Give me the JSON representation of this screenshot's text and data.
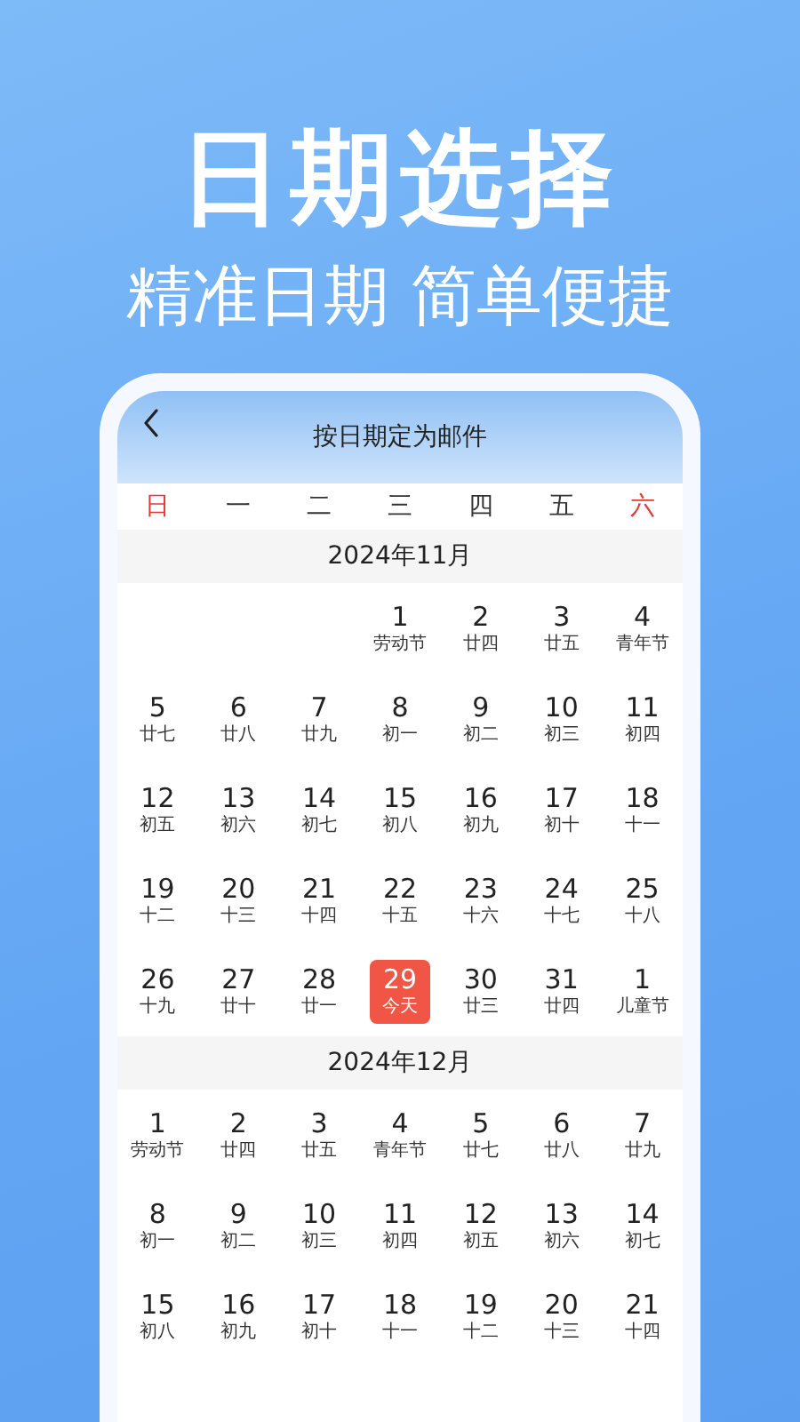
{
  "headline": "日期选择",
  "subtitle": "精准日期 简单便捷",
  "screen": {
    "title": "按日期定为邮件",
    "weekdays": [
      {
        "label": "日",
        "weekend": true
      },
      {
        "label": "一",
        "weekend": false
      },
      {
        "label": "二",
        "weekend": false
      },
      {
        "label": "三",
        "weekend": false
      },
      {
        "label": "四",
        "weekend": false
      },
      {
        "label": "五",
        "weekend": false
      },
      {
        "label": "六",
        "weekend": true
      }
    ],
    "months": [
      {
        "title": "2024年11月",
        "weeks": [
          [
            {
              "kind": "blank"
            },
            {
              "kind": "blank"
            },
            {
              "kind": "blank"
            },
            {
              "kind": "day",
              "day": "1",
              "note": "劳动节",
              "selected": false
            },
            {
              "kind": "day",
              "day": "2",
              "note": "廿四",
              "selected": false
            },
            {
              "kind": "day",
              "day": "3",
              "note": "廿五",
              "selected": false
            },
            {
              "kind": "day",
              "day": "4",
              "note": "青年节",
              "selected": false
            }
          ],
          [
            {
              "kind": "day",
              "day": "5",
              "note": "廿七",
              "selected": false
            },
            {
              "kind": "day",
              "day": "6",
              "note": "廿八",
              "selected": false
            },
            {
              "kind": "day",
              "day": "7",
              "note": "廿九",
              "selected": false
            },
            {
              "kind": "day",
              "day": "8",
              "note": "初一",
              "selected": false
            },
            {
              "kind": "day",
              "day": "9",
              "note": "初二",
              "selected": false
            },
            {
              "kind": "day",
              "day": "10",
              "note": "初三",
              "selected": false
            },
            {
              "kind": "day",
              "day": "11",
              "note": "初四",
              "selected": false
            }
          ],
          [
            {
              "kind": "day",
              "day": "12",
              "note": "初五",
              "selected": false
            },
            {
              "kind": "day",
              "day": "13",
              "note": "初六",
              "selected": false
            },
            {
              "kind": "day",
              "day": "14",
              "note": "初七",
              "selected": false
            },
            {
              "kind": "day",
              "day": "15",
              "note": "初八",
              "selected": false
            },
            {
              "kind": "day",
              "day": "16",
              "note": "初九",
              "selected": false
            },
            {
              "kind": "day",
              "day": "17",
              "note": "初十",
              "selected": false
            },
            {
              "kind": "day",
              "day": "18",
              "note": "十一",
              "selected": false
            }
          ],
          [
            {
              "kind": "day",
              "day": "19",
              "note": "十二",
              "selected": false
            },
            {
              "kind": "day",
              "day": "20",
              "note": "十三",
              "selected": false
            },
            {
              "kind": "day",
              "day": "21",
              "note": "十四",
              "selected": false
            },
            {
              "kind": "day",
              "day": "22",
              "note": "十五",
              "selected": false
            },
            {
              "kind": "day",
              "day": "23",
              "note": "十六",
              "selected": false
            },
            {
              "kind": "day",
              "day": "24",
              "note": "十七",
              "selected": false
            },
            {
              "kind": "day",
              "day": "25",
              "note": "十八",
              "selected": false
            }
          ],
          [
            {
              "kind": "day",
              "day": "26",
              "note": "十九",
              "selected": false
            },
            {
              "kind": "day",
              "day": "27",
              "note": "廿十",
              "selected": false
            },
            {
              "kind": "day",
              "day": "28",
              "note": "廿一",
              "selected": false
            },
            {
              "kind": "day",
              "day": "29",
              "note": "今天",
              "selected": true
            },
            {
              "kind": "day",
              "day": "30",
              "note": "廿三",
              "selected": false
            },
            {
              "kind": "day",
              "day": "31",
              "note": "廿四",
              "selected": false
            },
            {
              "kind": "day",
              "day": "1",
              "note": "儿童节",
              "selected": false
            }
          ]
        ]
      },
      {
        "title": "2024年12月",
        "weeks": [
          [
            {
              "kind": "day",
              "day": "1",
              "note": "劳动节",
              "selected": false
            },
            {
              "kind": "day",
              "day": "2",
              "note": "廿四",
              "selected": false
            },
            {
              "kind": "day",
              "day": "3",
              "note": "廿五",
              "selected": false
            },
            {
              "kind": "day",
              "day": "4",
              "note": "青年节",
              "selected": false
            },
            {
              "kind": "day",
              "day": "5",
              "note": "廿七",
              "selected": false
            },
            {
              "kind": "day",
              "day": "6",
              "note": "廿八",
              "selected": false
            },
            {
              "kind": "day",
              "day": "7",
              "note": "廿九",
              "selected": false
            }
          ],
          [
            {
              "kind": "day",
              "day": "8",
              "note": "初一",
              "selected": false
            },
            {
              "kind": "day",
              "day": "9",
              "note": "初二",
              "selected": false
            },
            {
              "kind": "day",
              "day": "10",
              "note": "初三",
              "selected": false
            },
            {
              "kind": "day",
              "day": "11",
              "note": "初四",
              "selected": false
            },
            {
              "kind": "day",
              "day": "12",
              "note": "初五",
              "selected": false
            },
            {
              "kind": "day",
              "day": "13",
              "note": "初六",
              "selected": false
            },
            {
              "kind": "day",
              "day": "14",
              "note": "初七",
              "selected": false
            }
          ],
          [
            {
              "kind": "day",
              "day": "15",
              "note": "初八",
              "selected": false
            },
            {
              "kind": "day",
              "day": "16",
              "note": "初九",
              "selected": false
            },
            {
              "kind": "day",
              "day": "17",
              "note": "初十",
              "selected": false
            },
            {
              "kind": "day",
              "day": "18",
              "note": "十一",
              "selected": false
            },
            {
              "kind": "day",
              "day": "19",
              "note": "十二",
              "selected": false
            },
            {
              "kind": "day",
              "day": "20",
              "note": "十三",
              "selected": false
            },
            {
              "kind": "day",
              "day": "21",
              "note": "十四",
              "selected": false
            }
          ]
        ]
      }
    ]
  }
}
